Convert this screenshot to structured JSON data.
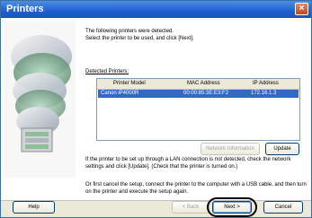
{
  "window": {
    "title": "Printers",
    "close_glyph": "×"
  },
  "main": {
    "intro": [
      "The following printers were detected.",
      "Select the printer to be used, and click [Next]."
    ],
    "detected_label": "Detected Printers:",
    "table": {
      "columns": [
        "Printer Model",
        "MAC Address",
        "IP Address"
      ],
      "rows": [
        {
          "model": "Canon iP4000R",
          "mac": "00:00:85:3E:E3:F2",
          "ip": "172.16.1.3"
        }
      ]
    },
    "buttons": {
      "network_information": "Network Information",
      "update": "Update"
    },
    "note1": "If the printer to be set up through a LAN connection is not detected, check the network settings and click [Update]. (Check that the printer is turned on.)",
    "note2": "Or first cancel the setup, connect the printer to the computer with a USB cable, and then turn on the printer and execute the setup again."
  },
  "footer": {
    "help": "Help",
    "back": "< Back",
    "next": "Next >",
    "cancel": "Cancel"
  },
  "colors": {
    "selection": "#316ac5",
    "titlebar": "#1f5fd0"
  },
  "icons": {
    "art": "cd-stack-illustration"
  }
}
